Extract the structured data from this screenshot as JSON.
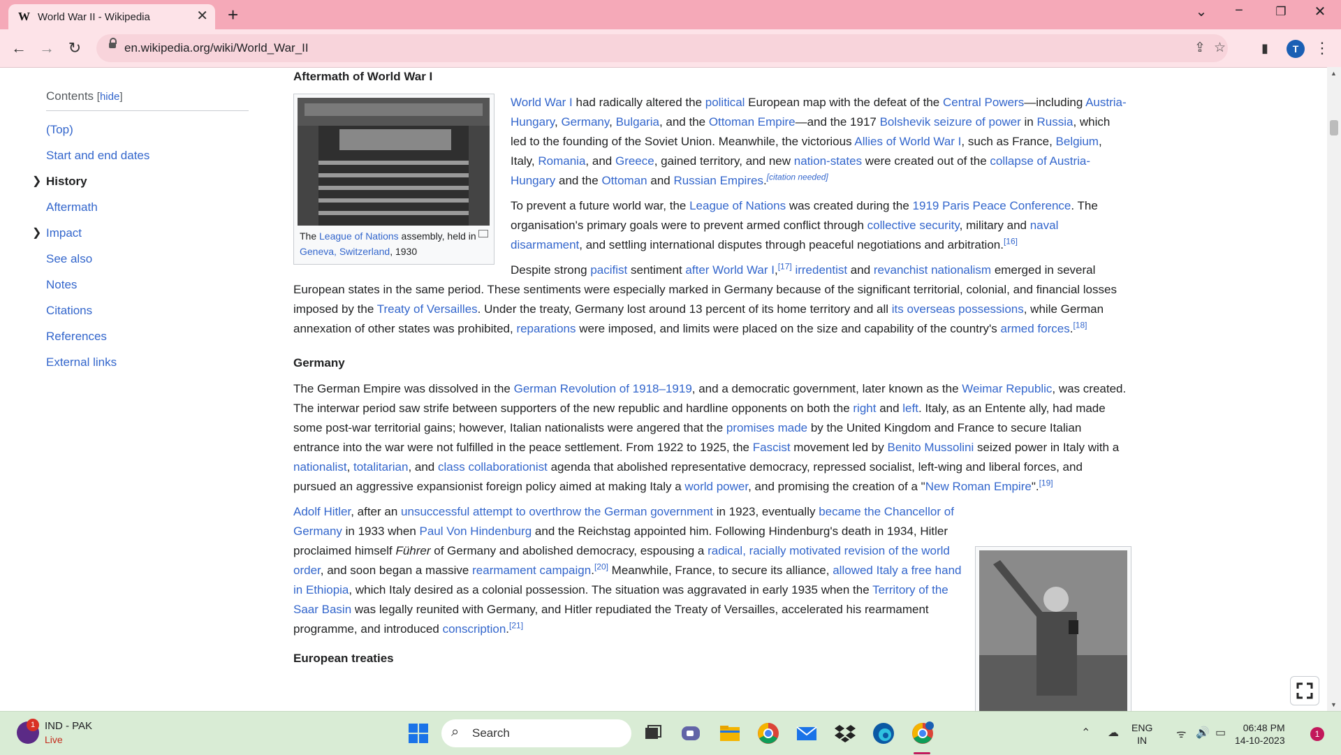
{
  "browser": {
    "tab_title": "World War II - Wikipedia",
    "tab_favicon": "W",
    "tab_close": "✕",
    "new_tab": "+",
    "url": "en.wikipedia.org/wiki/World_War_II",
    "profile_initial": "T"
  },
  "toc": {
    "title": "Contents",
    "hide_label": "hide",
    "items": [
      "(Top)",
      "Start and end dates",
      "History",
      "Aftermath",
      "Impact",
      "See also",
      "Notes",
      "Citations",
      "References",
      "External links"
    ]
  },
  "article": {
    "h_aftermath": "Aftermath of World War I",
    "fig1_caption": {
      "pre": "The ",
      "link": "League of Nations",
      "mid": " assembly, held in ",
      "link2": "Geneva, Switzerland",
      "post": ", 1930"
    },
    "p1": {
      "t1": "World War I",
      "t2": " had radically altered the ",
      "t3": "political",
      "t4": " European map with the defeat of the ",
      "t5": "Central Powers",
      "t6": "—including ",
      "t7": "Austria-Hungary",
      "t8": ", ",
      "t9": "Germany",
      "t10": ", ",
      "t11": "Bulgaria",
      "t12": ", and the ",
      "t13": "Ottoman Empire",
      "t14": "—and the 1917 ",
      "t15": "Bolshevik seizure of power",
      "t16": " in ",
      "t17": "Russia",
      "t18": ", which led to the founding of the Soviet Union. Meanwhile, the victorious ",
      "t19": "Allies of World War I",
      "t20": ", such as France, ",
      "t21": "Belgium",
      "t22": ", Italy, ",
      "t23": "Romania",
      "t24": ", and ",
      "t25": "Greece",
      "t26": ", gained territory, and new ",
      "t27": "nation-states",
      "t28": " were created out of the ",
      "t29": "collapse of Austria-Hungary",
      "t30": " and the ",
      "t31": "Ottoman",
      "t32": " and ",
      "t33": "Russian Empires",
      "t34": ".",
      "cite": "[citation needed]"
    },
    "p2": {
      "t1": "To prevent a future world war, the ",
      "t2": "League of Nations",
      "t3": " was created during the ",
      "t4": "1919 Paris Peace Conference",
      "t5": ". The organisation's primary goals were to prevent armed conflict through ",
      "t6": "collective security",
      "t7": ", military and ",
      "t8": "naval disarmament",
      "t9": ", and settling international disputes through peaceful negotiations and arbitration.",
      "ref": "[16]"
    },
    "p3": {
      "t1": "Despite strong ",
      "t2": "pacifist",
      "t3": " sentiment ",
      "t4": "after World War I",
      "t5": ",",
      "ref1": "[17]",
      "t6": " ",
      "t7": "irredentist",
      "t8": " and ",
      "t9": "revanchist nationalism",
      "t10": " emerged in several European states in the same period. These sentiments were especially marked in Germany because of the significant territorial, colonial, and financial losses imposed by the ",
      "t11": "Treaty of Versailles",
      "t12": ". Under the treaty, Germany lost around 13 percent of its home territory and all ",
      "t13": "its overseas possessions",
      "t14": ", while German annexation of other states was prohibited, ",
      "t15": "reparations",
      "t16": " were imposed, and limits were placed on the size and capability of the country's ",
      "t17": "armed forces",
      "t18": ".",
      "ref2": "[18]"
    },
    "h_germany": "Germany",
    "p4": {
      "t1": "The German Empire was dissolved in the ",
      "t2": "German Revolution of 1918–1919",
      "t3": ", and a democratic government, later known as the ",
      "t4": "Weimar Republic",
      "t5": ", was created. The interwar period saw strife between supporters of the new republic and hardline opponents on both the ",
      "t6": "right",
      "t7": " and ",
      "t8": "left",
      "t9": ". Italy, as an Entente ally, had made some post-war territorial gains; however, Italian nationalists were angered that the ",
      "t10": "promises made",
      "t11": " by the United Kingdom and France to secure Italian entrance into the war were not fulfilled in the peace settlement. From 1922 to 1925, the ",
      "t12": "Fascist",
      "t13": " movement led by ",
      "t14": "Benito Mussolini",
      "t15": " seized power in Italy with a ",
      "t16": "nationalist",
      "t17": ", ",
      "t18": "totalitarian",
      "t19": ", and ",
      "t20": "class collaborationist",
      "t21": " agenda that abolished representative democracy, repressed socialist, left-wing and liberal forces, and pursued an aggressive expansionist foreign policy aimed at making Italy a ",
      "t22": "world power",
      "t23": ", and promising the creation of a \"",
      "t24": "New Roman Empire",
      "t25": "\".",
      "ref": "[19]"
    },
    "p5": {
      "t1": "Adolf Hitler",
      "t2": ", after an ",
      "t3": "unsuccessful attempt to overthrow the German government",
      "t4": " in 1923, eventually ",
      "t5": "became the Chancellor of Germany",
      "t6": " in 1933 when ",
      "t7": "Paul Von Hindenburg",
      "t8": " and the Reichstag appointed him. Following Hindenburg's death in 1934, Hitler proclaimed himself ",
      "t9": "Führer",
      "t10": " of Germany and abolished democracy, espousing a ",
      "t11": "radical, racially motivated revision of the world order",
      "t12": ", and soon began a massive ",
      "t13": "rearmament campaign",
      "t14": ".",
      "ref1": "[20]",
      "t15": " Meanwhile, France, to secure its alliance, ",
      "t16": "allowed Italy a free hand in Ethiopia",
      "t17": ", which Italy desired as a colonial possession. The situation was aggravated in early 1935 when the ",
      "t18": "Territory of the Saar Basin",
      "t19": " was legally reunited with Germany, and Hitler repudiated the Treaty of Versailles, accelerated his rearmament programme, and introduced ",
      "t20": "conscription",
      "t21": ".",
      "ref2": "[21]"
    },
    "h_treaties": "European treaties"
  },
  "taskbar": {
    "news_title": "IND - PAK",
    "news_sub": "Live",
    "news_badge": "1",
    "search_label": "Search",
    "lang_1": "ENG",
    "lang_2": "IN",
    "time": "06:48 PM",
    "date": "14-10-2023",
    "notifications": "1"
  },
  "colors": {
    "titlebar": "#f5a9b8",
    "toolbar": "#fde3e8",
    "link": "#3366cc",
    "taskbar": "#d9ecd5"
  },
  "icons": [
    "wikipedia-favicon",
    "back-icon",
    "forward-icon",
    "reload-icon",
    "lock-icon",
    "share-icon",
    "bookmark-star-icon",
    "sidepanel-icon",
    "menu-icon",
    "fullscreen-icon",
    "windows-start-icon",
    "search-icon",
    "task-view-icon",
    "chat-icon",
    "file-explorer-icon",
    "chrome-icon",
    "mail-icon",
    "dropbox-icon",
    "edge-icon",
    "chrome-profile-icon",
    "wifi-icon",
    "volume-icon",
    "battery-icon",
    "onedrive-icon"
  ]
}
